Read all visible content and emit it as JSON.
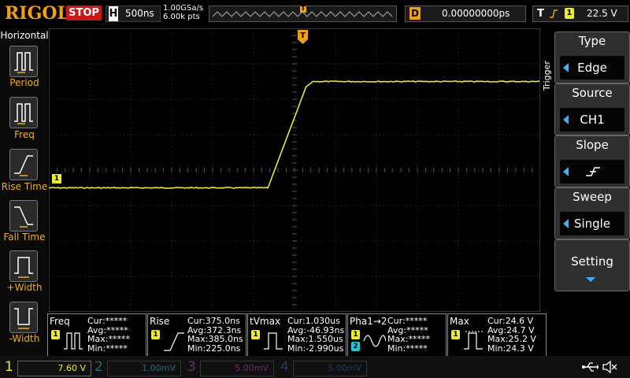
{
  "brand": "RIGOL",
  "status": "STOP",
  "timebase": {
    "label": "H",
    "value": "500ns"
  },
  "acquisition": {
    "sample_rate": "1.00GSa/s",
    "points": "6.00k pts"
  },
  "trigger_marker": "T",
  "delay": {
    "label": "D",
    "value": "0.00000000ps"
  },
  "trigger_status": {
    "label": "T",
    "channel": "1",
    "level": "22.5 V"
  },
  "horizontal_menu": {
    "title": "Horizontal",
    "items": [
      {
        "label": "Period",
        "icon": "period-icon"
      },
      {
        "label": "Freq",
        "icon": "freq-icon"
      },
      {
        "label": "Rise Time",
        "icon": "rise-time-icon"
      },
      {
        "label": "Fall Time",
        "icon": "fall-time-icon"
      },
      {
        "label": "+Width",
        "icon": "positive-width-icon"
      },
      {
        "label": "-Width",
        "icon": "negative-width-icon"
      }
    ]
  },
  "trigger_menu": {
    "title": "Trigger",
    "items": [
      {
        "title": "Type",
        "value": "Edge"
      },
      {
        "title": "Source",
        "value": "CH1"
      },
      {
        "title": "Slope",
        "value": ""
      },
      {
        "title": "Sweep",
        "value": "Single"
      },
      {
        "title": "Setting",
        "value": ""
      }
    ]
  },
  "waveform": {
    "channel_marker": "1",
    "low_level_div": -0.5,
    "high_level_div": 2.5,
    "rise_start_div": -0.65,
    "rise_end_div": 0.1,
    "color": "#e8e83a"
  },
  "measurements": [
    {
      "name": "Freq",
      "badge": "1",
      "badge2": "",
      "cur": "Cur:*****",
      "avg": "Avg:*****",
      "max": "Max:*****",
      "min": "Min:*****"
    },
    {
      "name": "Rise",
      "badge": "1",
      "badge2": "",
      "cur": "Cur:375.0ns",
      "avg": "Avg:372.3ns",
      "max": "Max:385.0ns",
      "min": "Min:225.0ns"
    },
    {
      "name": "tVmax",
      "badge": "1",
      "badge2": "",
      "cur": "Cur:1.030us",
      "avg": "Avg:-46.93ns",
      "max": "Max:1.550us",
      "min": "Min:-2.990us"
    },
    {
      "name": "Pha1→2",
      "badge": "1",
      "badge2": "2",
      "cur": "Cur:*****",
      "avg": "Avg:*****",
      "max": "Max:*****",
      "min": "Min:*****"
    },
    {
      "name": "Max",
      "badge": "1",
      "badge2": "",
      "cur": "Cur:24.6 V",
      "avg": "Avg:24.7 V",
      "max": "Max:25.2 V",
      "min": "Min:24.3 V"
    }
  ],
  "channels": [
    {
      "num": "1",
      "scale": "7.60 V",
      "color": "#ecec30"
    },
    {
      "num": "2",
      "scale": "1.00mV",
      "color": "#1e6a70"
    },
    {
      "num": "3",
      "scale": "5.00mV",
      "color": "#6a2a6a"
    },
    {
      "num": "4",
      "scale": "5.00mV",
      "color": "#1e3a6a"
    }
  ],
  "colors": {
    "accent": "#f0a010",
    "trace": "#e8e83a",
    "stop": "#c81818",
    "menu_arrow": "#3ab0ff"
  }
}
